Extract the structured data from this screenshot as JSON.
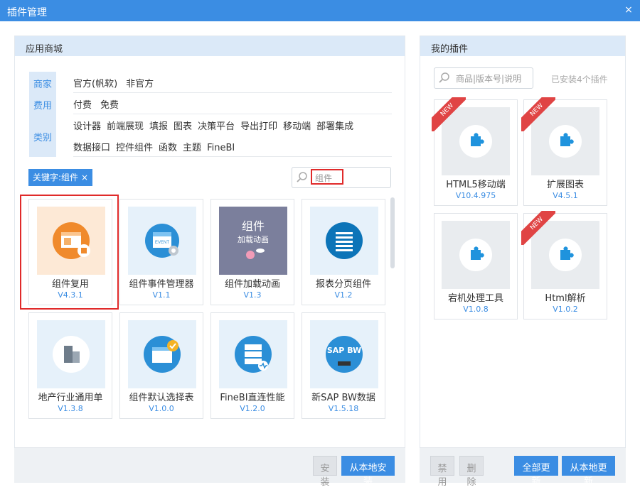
{
  "window": {
    "title": "插件管理",
    "close_label": "×"
  },
  "store": {
    "header": "应用商城",
    "filter_tabs": [
      "商家",
      "费用",
      "类别"
    ],
    "vendor_options": [
      "官方(帆软)",
      "非官方"
    ],
    "fee_options": [
      "付费",
      "免费"
    ],
    "category_row1": [
      "设计器",
      "前端展现",
      "填报",
      "图表",
      "决策平台",
      "导出打印",
      "移动端",
      "部署集成"
    ],
    "category_row2": [
      "数据接口",
      "控件组件",
      "函数",
      "主题",
      "FineBI"
    ],
    "keyword_tag": "关键字:组件",
    "keyword_tag_close": "×",
    "search_value": "组件",
    "plugins": [
      {
        "name": "组件复用",
        "version": "V4.3.1"
      },
      {
        "name": "组件事件管理器",
        "version": "V1.1"
      },
      {
        "name": "组件加载动画",
        "version": "V1.3",
        "thumb_title": "组件",
        "thumb_sub": "加载动画"
      },
      {
        "name": "报表分页组件",
        "version": "V1.2"
      },
      {
        "name": "地产行业通用单",
        "version": "V1.3.8"
      },
      {
        "name": "组件默认选择表",
        "version": "V1.0.0"
      },
      {
        "name": "FineBI直连性能",
        "version": "V1.2.0"
      },
      {
        "name": "新SAP BW数据",
        "version": "V1.5.18",
        "thumb_title": "SAP BW"
      }
    ],
    "buttons": {
      "install": "安装",
      "install_local": "从本地安装"
    }
  },
  "mine": {
    "header": "我的插件",
    "search_placeholder": "商品|版本号|说明",
    "installed_count": "已安装4个插件",
    "new_badge": "NEW",
    "plugins": [
      {
        "name": "HTML5移动端",
        "version": "V10.4.975",
        "is_new": true
      },
      {
        "name": "扩展图表",
        "version": "V4.5.1",
        "is_new": true
      },
      {
        "name": "宕机处理工具",
        "version": "V1.0.8",
        "is_new": false
      },
      {
        "name": "Html解析",
        "version": "V1.0.2",
        "is_new": true
      }
    ],
    "buttons": {
      "disable": "禁用",
      "delete": "删除",
      "update_all": "全部更新",
      "update_local": "从本地更新"
    }
  },
  "colors": {
    "accent": "#3b8de3",
    "header_bg": "#dbe9f8",
    "highlight": "#e02a2a",
    "new_ribbon": "#e04444"
  }
}
